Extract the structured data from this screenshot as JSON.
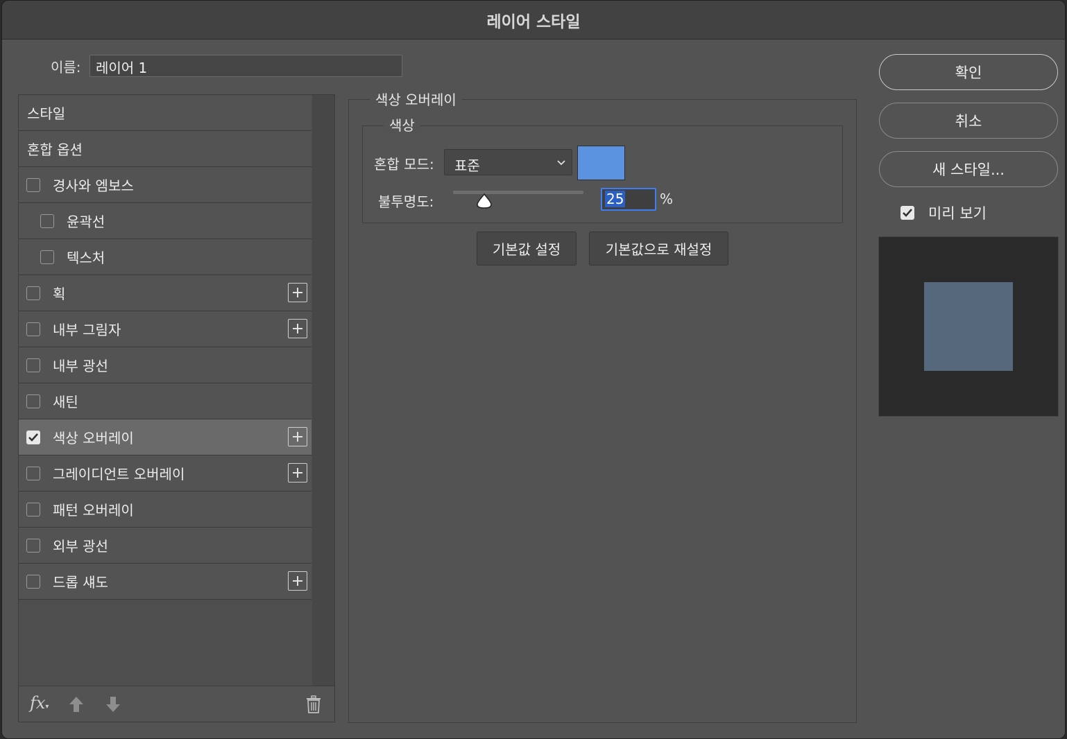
{
  "window": {
    "title": "레이어 스타일"
  },
  "name_field": {
    "label": "이름:",
    "value": "레이어 1"
  },
  "styles": {
    "items": [
      {
        "label": "스타일",
        "checkbox": false,
        "checked": false,
        "plus": false,
        "indent": false,
        "selected": false
      },
      {
        "label": "혼합 옵션",
        "checkbox": false,
        "checked": false,
        "plus": false,
        "indent": false,
        "selected": false
      },
      {
        "label": "경사와 엠보스",
        "checkbox": true,
        "checked": false,
        "plus": false,
        "indent": false,
        "selected": false
      },
      {
        "label": "윤곽선",
        "checkbox": true,
        "checked": false,
        "plus": false,
        "indent": true,
        "selected": false
      },
      {
        "label": "텍스처",
        "checkbox": true,
        "checked": false,
        "plus": false,
        "indent": true,
        "selected": false
      },
      {
        "label": "획",
        "checkbox": true,
        "checked": false,
        "plus": true,
        "indent": false,
        "selected": false
      },
      {
        "label": "내부 그림자",
        "checkbox": true,
        "checked": false,
        "plus": true,
        "indent": false,
        "selected": false
      },
      {
        "label": "내부 광선",
        "checkbox": true,
        "checked": false,
        "plus": false,
        "indent": false,
        "selected": false
      },
      {
        "label": "새틴",
        "checkbox": true,
        "checked": false,
        "plus": false,
        "indent": false,
        "selected": false
      },
      {
        "label": "색상 오버레이",
        "checkbox": true,
        "checked": true,
        "plus": true,
        "indent": false,
        "selected": true
      },
      {
        "label": "그레이디언트 오버레이",
        "checkbox": true,
        "checked": false,
        "plus": true,
        "indent": false,
        "selected": false
      },
      {
        "label": "패턴 오버레이",
        "checkbox": true,
        "checked": false,
        "plus": false,
        "indent": false,
        "selected": false
      },
      {
        "label": "외부 광선",
        "checkbox": true,
        "checked": false,
        "plus": false,
        "indent": false,
        "selected": false
      },
      {
        "label": "드롭 섀도",
        "checkbox": true,
        "checked": false,
        "plus": true,
        "indent": false,
        "selected": false
      }
    ],
    "bottom_bar": {
      "fx_label": "fx",
      "icons": [
        "move-up-icon",
        "move-down-icon",
        "trash-icon"
      ]
    }
  },
  "color_overlay": {
    "group_title": "색상 오버레이",
    "subgroup_title": "색상",
    "blend_mode_label": "혼합 모드:",
    "blend_mode_value": "표준",
    "overlay_color": "#5b93e0",
    "opacity_label": "불투명도:",
    "opacity_value": "25",
    "opacity_unit": "%",
    "make_default_label": "기본값 설정",
    "reset_default_label": "기본값으로 재설정"
  },
  "actions": {
    "ok_label": "확인",
    "cancel_label": "취소",
    "new_style_label": "새 스타일...",
    "preview_label": "미리 보기",
    "preview_checked": true,
    "preview_color": "#56687c"
  }
}
